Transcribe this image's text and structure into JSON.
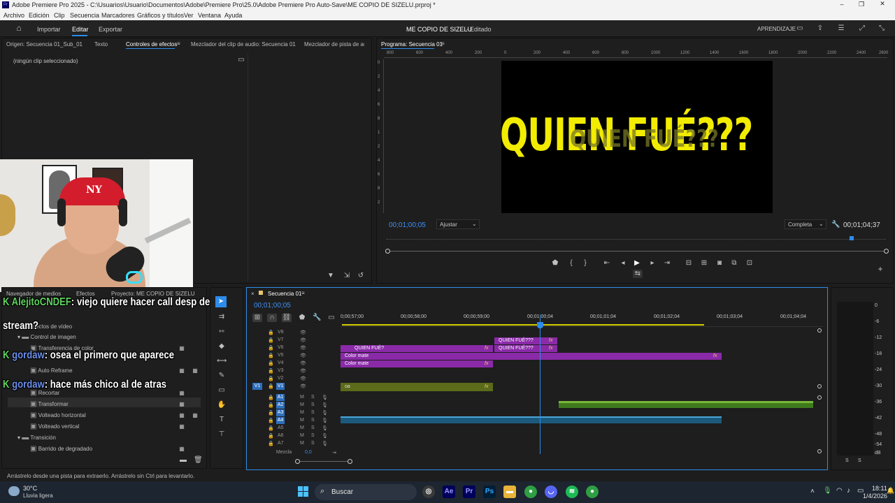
{
  "titlebar": {
    "title": "Adobe Premiere Pro 2025 - C:\\Usuarios\\Usuario\\Documentos\\Adobe\\Premiere Pro\\25.0\\Adobe Premiere Pro Auto-Save\\ME COPIO DE SIZELU.prproj *"
  },
  "menu": [
    "Archivo",
    "Edición",
    "Clip",
    "Secuencia",
    "Marcadores",
    "Gráficos y títulos",
    "Ver",
    "Ventana",
    "Ayuda"
  ],
  "workspace": {
    "tabs": [
      "Importar",
      "Editar",
      "Exportar"
    ],
    "active": "Editar",
    "project": "ME COPIO DE SIZELU",
    "status": "Editado",
    "right_label": "APRENDIZAJE"
  },
  "source_panel": {
    "tabs": [
      "Origen: Secuencia 01_Sub_01",
      "Texto",
      "Controles de efectos",
      "Mezclador del clip de audio: Secuencia 01",
      "Mezclador de pista de audio"
    ],
    "active": "Controles de efectos",
    "empty": "(ningún clip seleccionado)"
  },
  "program": {
    "title": "Programa: Secuencia 01",
    "ruler": [
      "800",
      "600",
      "400",
      "200",
      "0",
      "200",
      "400",
      "600",
      "800",
      "1000",
      "1200",
      "1400",
      "1600",
      "1800",
      "2000",
      "2200",
      "2400",
      "2600"
    ],
    "vruler": [
      "0",
      "2",
      "4",
      "6",
      "8",
      "1",
      "2",
      "4",
      "6",
      "8",
      "2"
    ],
    "frame_text": "QUIEN FUÉ???",
    "ghost_text": "QUIEN FUÉ???",
    "timecode": "00;01;00;05",
    "fit": "Ajustar",
    "quality": "Completa",
    "duration": "00;01;04;37"
  },
  "effects_panel": {
    "tabs": [
      "Navegador de medios",
      "Efectos",
      "Proyecto: ME COPIO DE SIZELU"
    ],
    "items": [
      {
        "label": "Efectos de vídeo",
        "indent": 0
      },
      {
        "label": "Control de imagen",
        "indent": 1
      },
      {
        "label": "Transferencia de color",
        "indent": 2
      },
      {
        "label": "Auto Reframe",
        "indent": 2
      },
      {
        "label": "Recortar",
        "indent": 2
      },
      {
        "label": "Transformar",
        "indent": 2
      },
      {
        "label": "Volteado horizontal",
        "indent": 2
      },
      {
        "label": "Volteado vertical",
        "indent": 2
      },
      {
        "label": "Transición",
        "indent": 1
      },
      {
        "label": "Barrido de degradado",
        "indent": 2
      }
    ]
  },
  "chat": [
    {
      "user": "AlejitoCNDEF",
      "msg": ": viejo quiere hacer call desp del",
      "cont": "stream?",
      "color": "#5fd35f"
    },
    {
      "user": "gordaw",
      "msg": ": osea el primero que aparece",
      "color": "#6b8ee8"
    },
    {
      "user": "gordaw",
      "msg": ": hace más chico al de atras",
      "color": "#6b8ee8"
    }
  ],
  "timeline": {
    "title": "Secuencia 01",
    "timecode": "00;01;00;05",
    "ruler": [
      "0;00;57;00",
      "00;00;58;00",
      "00;00;59;00",
      "00;01;00;04",
      "00;01;01;04",
      "00;01;02;04",
      "00;01;03;04",
      "00;01;04;04"
    ],
    "video_tracks": [
      "V8",
      "V7",
      "V6",
      "V5",
      "V4",
      "V3",
      "V2",
      "V1"
    ],
    "audio_tracks": [
      "A1",
      "A2",
      "A3",
      "A4",
      "A5",
      "A6",
      "A7"
    ],
    "mix_label": "Mezcla",
    "mix_value": "0,0",
    "clips": {
      "v7": "QUIEN FUÉ???",
      "v6a": "QUIEN FUÉ?",
      "v6b": "QUIEN FUÉ???",
      "v5": "Color mate",
      "v4": "Color mate",
      "v1": "oa"
    }
  },
  "meter": {
    "scale": [
      "0",
      "-6",
      "-12",
      "-18",
      "-24",
      "-30",
      "-36",
      "-42",
      "-48",
      "-54",
      "dB"
    ],
    "footer": [
      "S",
      "S"
    ]
  },
  "status": {
    "hint": "Arrástrelo desde una pista para extraerlo. Arrástrelo sin Ctrl para levantarlo."
  },
  "taskbar": {
    "temp": "30°C",
    "weather": "Lluvia ligera",
    "search": "Buscar",
    "time": "18:11",
    "date": "1/4/2026"
  },
  "colors": {
    "accent": "#2d8ceb",
    "clip_purple": "#8a2aa8",
    "yellow": "#f2ec00"
  }
}
